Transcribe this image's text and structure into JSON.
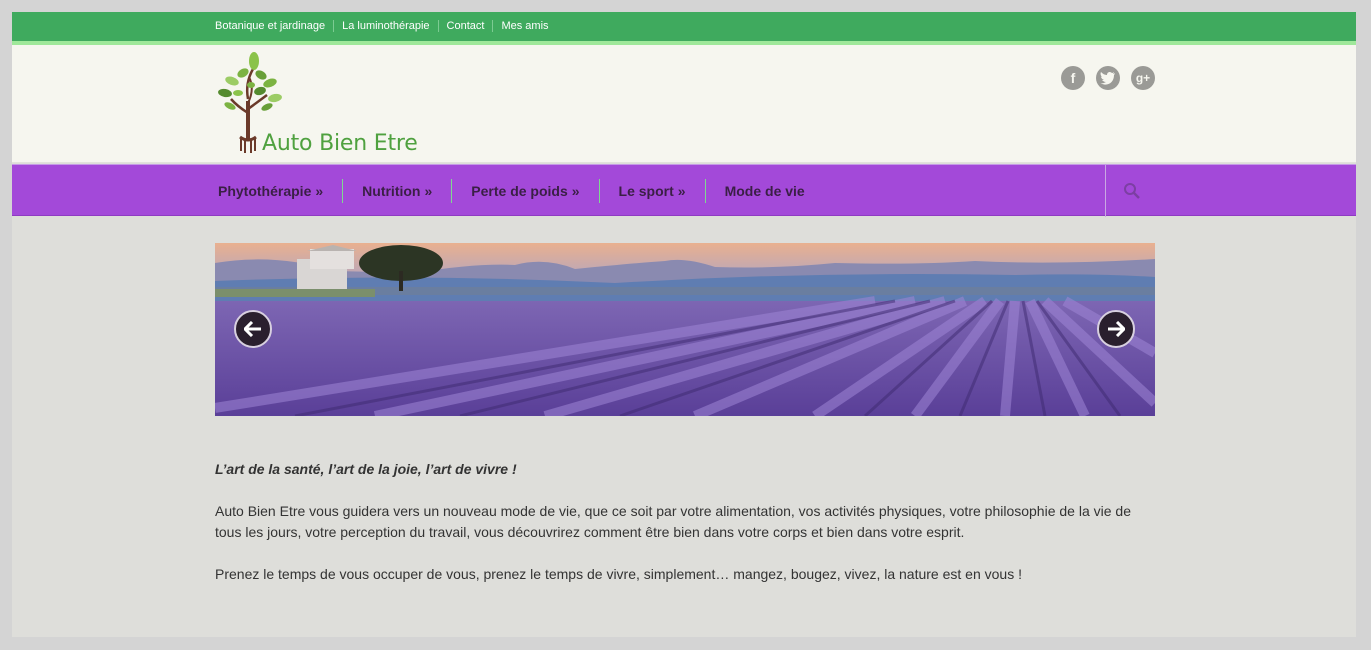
{
  "topbar": {
    "links": [
      "Botanique et jardinage",
      "La luminothérapie",
      "Contact",
      "Mes amis"
    ]
  },
  "header": {
    "logo_text": "Auto Bien Etre",
    "social": [
      {
        "icon": "facebook-icon",
        "glyph": "f"
      },
      {
        "icon": "twitter-icon",
        "glyph": "t"
      },
      {
        "icon": "google-plus-icon",
        "glyph": "g+"
      }
    ]
  },
  "nav": {
    "items": [
      {
        "label": "Phytothérapie",
        "arrow": "»"
      },
      {
        "label": "Nutrition",
        "arrow": "»"
      },
      {
        "label": "Perte de poids",
        "arrow": "»"
      },
      {
        "label": "Le sport",
        "arrow": "»"
      },
      {
        "label": "Mode de vie",
        "arrow": ""
      }
    ],
    "search_icon": "search-icon"
  },
  "slider": {
    "image": "lavender-field-image",
    "prev_icon": "arrow-left-icon",
    "next_icon": "arrow-right-icon"
  },
  "content": {
    "tagline": "L’art de la santé, l’art de la joie, l’art de vivre !",
    "paragraph1": "Auto Bien Etre vous guidera vers un nouveau mode de vie, que ce soit par votre alimentation, vos activités physiques, votre philosophie de la vie de tous les jours, votre perception du travail, vous découvrirez comment être bien dans votre corps et bien dans votre esprit.",
    "paragraph2": "Prenez le temps de vous occuper de vous, prenez le temps de vivre, simplement… mangez, bougez, vivez, la nature est en vous !"
  },
  "colors": {
    "topbar": "#3faa5e",
    "nav": "#a349d9",
    "header_bg": "#f6f6ef",
    "page_bg": "#dededa",
    "logo_green": "#4fa13f"
  }
}
